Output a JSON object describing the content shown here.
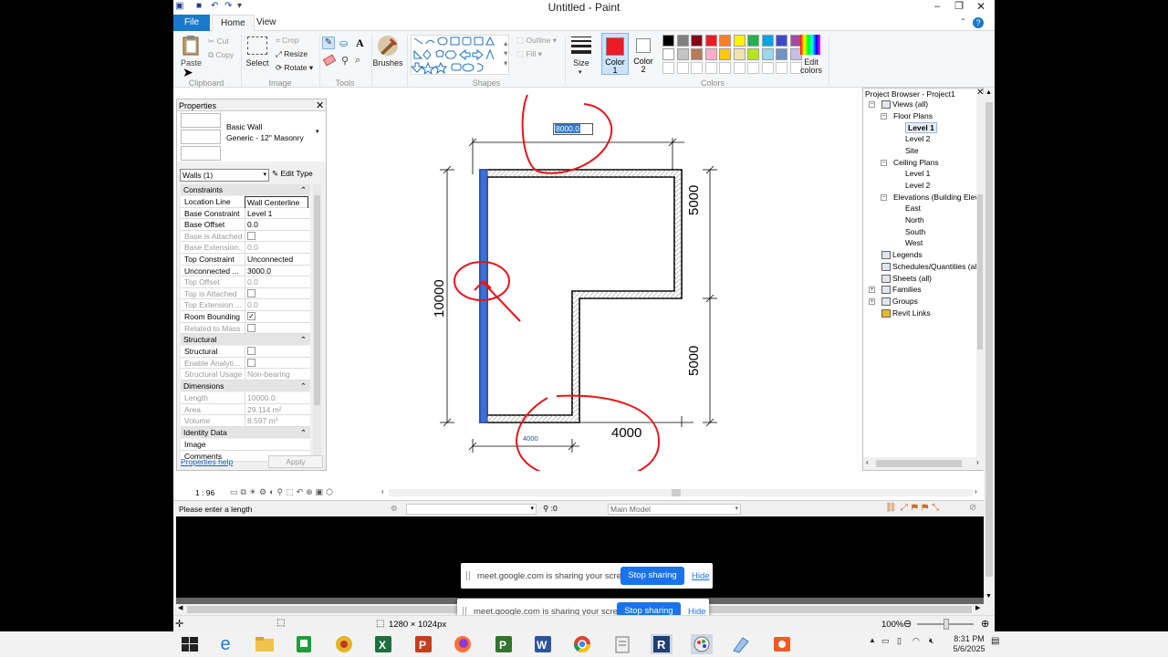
{
  "window": {
    "title": "Untitled - Paint",
    "help": "?"
  },
  "tabs": [
    {
      "label": "File"
    },
    {
      "label": "Home"
    },
    {
      "label": "View"
    }
  ],
  "ribbon": {
    "clipboard": {
      "label": "Clipboard",
      "paste": "Paste",
      "cut": "Cut",
      "copy": "Copy"
    },
    "image": {
      "label": "Image",
      "select": "Select",
      "crop": "Crop",
      "resize": "Resize",
      "rotate": "Rotate"
    },
    "tools": {
      "label": "Tools"
    },
    "brushes": "Brushes",
    "shapes": {
      "label": "Shapes",
      "outline": "Outline",
      "fill": "Fill"
    },
    "size": "Size",
    "color1": {
      "label": "Color",
      "num": "1",
      "value": "#ed1c24"
    },
    "color2": {
      "label": "Color",
      "num": "2",
      "value": "#ffffff"
    },
    "colors": {
      "label": "Colors",
      "edit_label": "Edit",
      "edit_label2": "colors"
    },
    "palette_row1": [
      "#000000",
      "#7f7f7f",
      "#880015",
      "#ed1c24",
      "#ff7f27",
      "#fff200",
      "#22b14c",
      "#00a2e8",
      "#3f48cc",
      "#a349a4"
    ],
    "palette_row2": [
      "#ffffff",
      "#c3c3c3",
      "#b97a57",
      "#ffaec9",
      "#ffc90e",
      "#efe4b0",
      "#b5e61d",
      "#99d9ea",
      "#7092be",
      "#c8bfe7"
    ]
  },
  "properties": {
    "title": "Properties",
    "type_name": "Basic Wall",
    "type_sub": "Generic - 12\" Masonry",
    "selector": "Walls (1)",
    "edit_type": "Edit Type",
    "sections": {
      "constraints": "Constraints",
      "structural": "Structural",
      "dimensions": "Dimensions",
      "identity": "Identity Data"
    },
    "rows": [
      {
        "k": "Location Line",
        "v": "Wall Centerline"
      },
      {
        "k": "Base Constraint",
        "v": "Level 1"
      },
      {
        "k": "Base Offset",
        "v": "0.0"
      },
      {
        "k": "Base is Attached",
        "v": ""
      },
      {
        "k": "Base Extension...",
        "v": "0.0"
      },
      {
        "k": "Top Constraint",
        "v": "Unconnected"
      },
      {
        "k": "Unconnected ...",
        "v": "3000.0"
      },
      {
        "k": "Top Offset",
        "v": "0.0"
      },
      {
        "k": "Top is Attached",
        "v": ""
      },
      {
        "k": "Top Extension ...",
        "v": "0.0"
      },
      {
        "k": "Room Bounding",
        "v": "✓"
      },
      {
        "k": "Related to Mass",
        "v": ""
      }
    ],
    "structural_rows": [
      {
        "k": "Structural",
        "v": ""
      },
      {
        "k": "Enable Analyti...",
        "v": ""
      },
      {
        "k": "Structural Usage",
        "v": "Non-bearing"
      }
    ],
    "dimension_rows": [
      {
        "k": "Length",
        "v": "10000.0"
      },
      {
        "k": "Area",
        "v": "29.114 m²"
      },
      {
        "k": "Volume",
        "v": "8.597 m³"
      }
    ],
    "identity_rows": [
      {
        "k": "Image",
        "v": ""
      },
      {
        "k": "Comments",
        "v": ""
      }
    ],
    "help": "Properties help",
    "apply": "Apply"
  },
  "drawing": {
    "temp_dim": "8000.0",
    "dim_5000_top": "5000",
    "dim_5000_bottom": "5000",
    "dim_10000": "10000",
    "dim_4000": "4000",
    "dim_4000_small": "4000"
  },
  "browser": {
    "title": "Project Browser - Project1",
    "items": [
      {
        "label": "Views (all)"
      },
      {
        "label": "Floor Plans"
      },
      {
        "label": "Level 1"
      },
      {
        "label": "Level 2"
      },
      {
        "label": "Site"
      },
      {
        "label": "Ceiling Plans"
      },
      {
        "label": "Level 1"
      },
      {
        "label": "Level 2"
      },
      {
        "label": "Elevations (Building Elevation)"
      },
      {
        "label": "East"
      },
      {
        "label": "North"
      },
      {
        "label": "South"
      },
      {
        "label": "West"
      },
      {
        "label": "Legends"
      },
      {
        "label": "Schedules/Quantities (all)"
      },
      {
        "label": "Sheets (all)"
      },
      {
        "label": "Families"
      },
      {
        "label": "Groups"
      },
      {
        "label": "Revit Links"
      }
    ]
  },
  "view_bar": {
    "scale": "1 : 96"
  },
  "status": {
    "prompt": "Please enter a length",
    "filter_count": ":0",
    "model": "Main Model"
  },
  "sharing": {
    "message": "meet.google.com is sharing your screen.",
    "stop": "Stop sharing",
    "hide": "Hide"
  },
  "paint_status": {
    "dimensions": "1280 × 1024px",
    "zoom": "100%"
  },
  "taskbar": {
    "time": "8:31 PM",
    "date": "5/6/2025"
  }
}
